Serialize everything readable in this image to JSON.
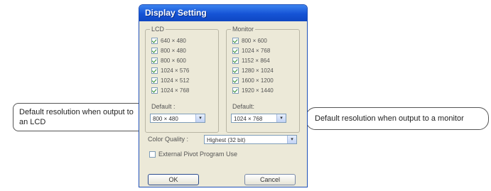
{
  "window": {
    "title": "Display Setting"
  },
  "lcd": {
    "label": "LCD",
    "items": [
      "640 × 480",
      "800 × 480",
      "800 × 600",
      "1024 × 576",
      "1024 × 512",
      "1024 × 768"
    ],
    "default_label": "Default :",
    "default_value": "800 × 480"
  },
  "monitor": {
    "label": "Monitor",
    "items": [
      "800 × 600",
      "1024 × 768",
      "1152 × 864",
      "1280 × 1024",
      "1600 × 1200",
      "1920 × 1440"
    ],
    "default_label": "Default:",
    "default_value": "1024 × 768"
  },
  "color_quality": {
    "label": "Color Quality :",
    "value": "Highest (32 bit)"
  },
  "pivot": {
    "label": "External Pivot Program Use",
    "checked": false
  },
  "buttons": {
    "ok": "OK",
    "cancel": "Cancel"
  },
  "callouts": {
    "lcd": "Default resolution when output to an LCD",
    "monitor": "Default resolution when output to a monitor"
  },
  "arrow_glyph": "▾"
}
